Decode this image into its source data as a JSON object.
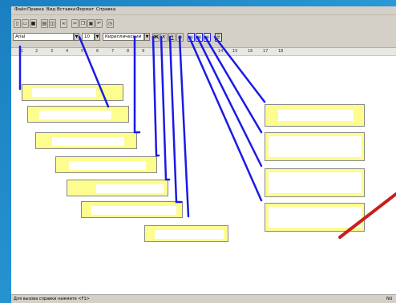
{
  "menu": [
    "Файл",
    "Правка",
    "Вид",
    "Вставка",
    "Формат",
    "Справка"
  ],
  "toolbar": {
    "font_name": "Arial",
    "font_size": "10",
    "charset": "Кириллический",
    "bold": "Ж",
    "italic": "К",
    "underline": "Ч"
  },
  "ruler": [
    "1",
    "2",
    "3",
    "4",
    "5",
    "6",
    "7",
    "8",
    "9",
    "14",
    "15",
    "16",
    "17",
    "18"
  ],
  "status": {
    "hint": "Для вызова справки нажмите <F1>",
    "mode": "NU"
  },
  "colors": {
    "background": "#1d86c4",
    "callout_fill": "#fdfc8e",
    "connector": "#1a1ae6",
    "pointer": "#c81e1e"
  }
}
